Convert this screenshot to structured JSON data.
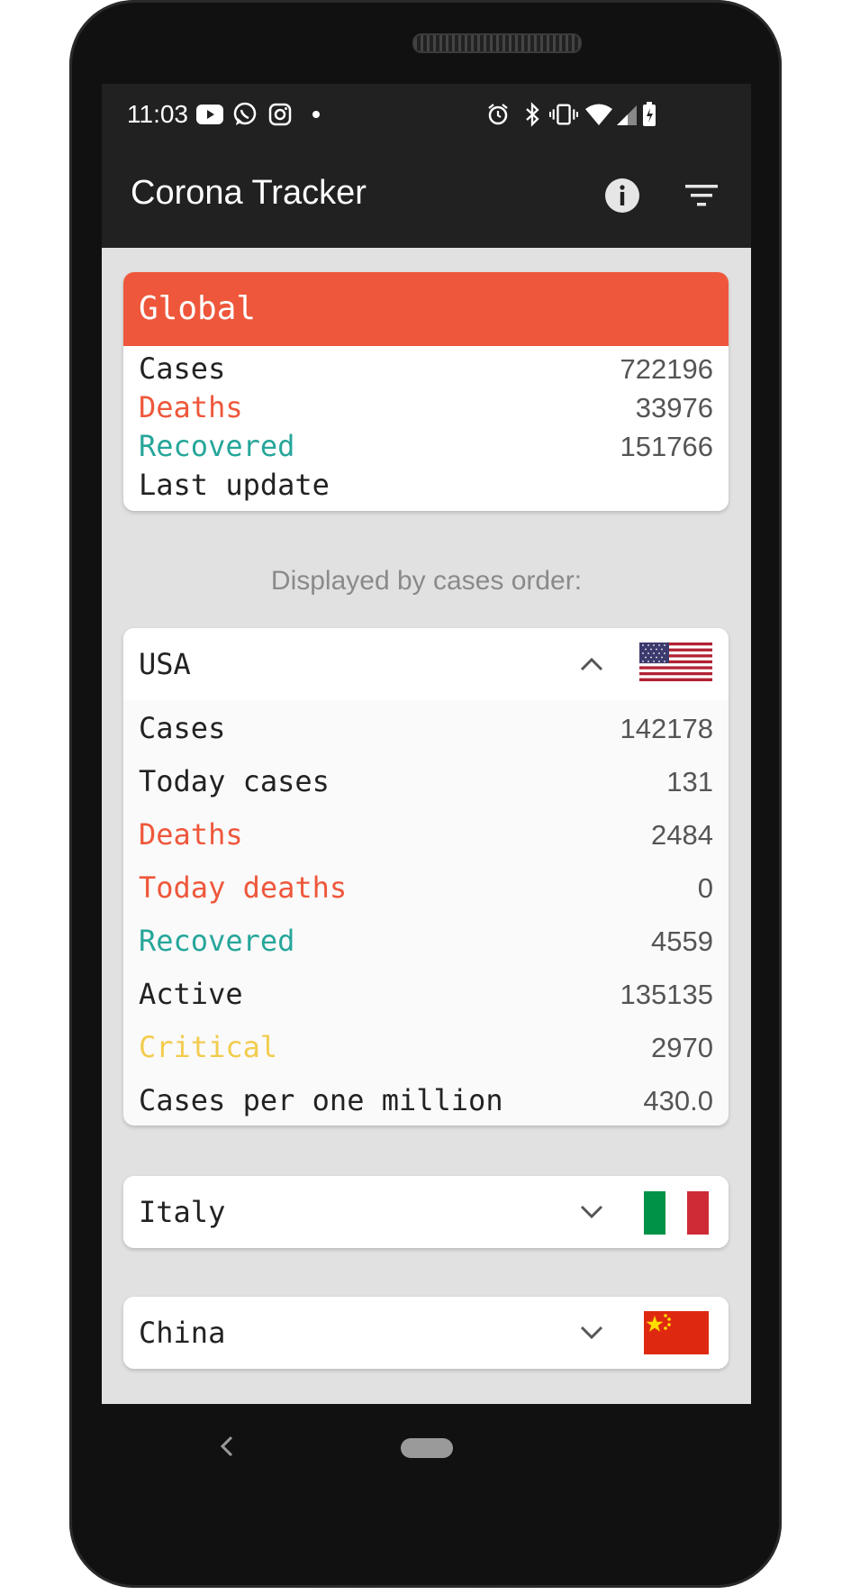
{
  "status_bar": {
    "time": "11:03",
    "left_icons": [
      "youtube-icon",
      "whatsapp-icon",
      "instagram-icon",
      "dot-icon"
    ],
    "right_icons": [
      "alarm-icon",
      "bluetooth-icon",
      "vibrate-icon",
      "wifi-icon",
      "signal-icon",
      "battery-icon"
    ]
  },
  "app_bar": {
    "title": "Corona Tracker",
    "info_icon": "info-icon",
    "filter_icon": "filter-icon"
  },
  "global": {
    "title": "Global",
    "rows": [
      {
        "label": "Cases",
        "value": "722196"
      },
      {
        "label": "Deaths",
        "value": "33976"
      },
      {
        "label": "Recovered",
        "value": "151766"
      },
      {
        "label": "Last update",
        "value": ""
      }
    ]
  },
  "subtitle": "Displayed by cases order:",
  "countries": [
    {
      "name": "USA",
      "expanded": true,
      "rows": [
        {
          "label": "Cases",
          "value": "142178"
        },
        {
          "label": "Today cases",
          "value": "131"
        },
        {
          "label": "Deaths",
          "value": "2484"
        },
        {
          "label": "Today deaths",
          "value": "0"
        },
        {
          "label": "Recovered",
          "value": "4559"
        },
        {
          "label": "Active",
          "value": "135135"
        },
        {
          "label": "Critical",
          "value": "2970"
        },
        {
          "label": "Cases per one million",
          "value": "430.0"
        }
      ]
    },
    {
      "name": "Italy",
      "expanded": false
    },
    {
      "name": "China",
      "expanded": false
    }
  ],
  "colors": {
    "accent": "#ee573b",
    "deaths": "#ee573b",
    "recovered": "#26a69a",
    "critical": "#f2cc4e",
    "text": "#222222",
    "bar": "#212121"
  }
}
